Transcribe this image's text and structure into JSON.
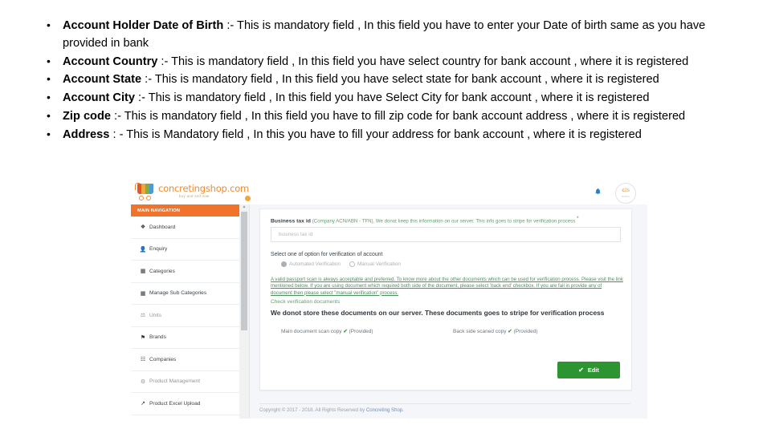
{
  "slide": {
    "bullets": [
      {
        "lead": "Account Holder Date of Birth",
        "rest": " :- This is mandatory field , In this field you have to enter your Date of birth same as you have provided in bank"
      },
      {
        "lead": "Account Country",
        "rest": " :- This is mandatory field , In this field you have select country for bank account , where it is registered"
      },
      {
        "lead": "Account State",
        "rest": " :- This is mandatory field , In this field you have select state for bank account , where it is registered"
      },
      {
        "lead": "Account City",
        "rest": " :- This is mandatory field , In this field you have Select City  for bank account , where it is registered"
      },
      {
        "lead": "Zip code",
        "rest": " :- This is mandatory field , In this field you have to fill zip code for bank account address , where it is registered"
      },
      {
        "lead": "Address",
        "rest": " : -  This is Mandatory field ,  In this you have to fill your address for bank account , where it is registered"
      }
    ]
  },
  "screenshot": {
    "brand": {
      "name": "concretingshop.com",
      "tagline": "buy and sell now"
    },
    "topbar": {
      "bell_icon": "bell-icon",
      "avatar_initials": [
        "c",
        "2",
        "s"
      ],
      "avatar_sub": "SUPPLY"
    },
    "sidebar": {
      "header": "MAIN NAVIGATION",
      "items": [
        {
          "label": "Dashboard",
          "icon": "dashboard-icon",
          "glyph": "❖"
        },
        {
          "label": "Enquiry",
          "icon": "user-icon",
          "glyph": "☰"
        },
        {
          "label": "Categories",
          "icon": "grid-icon",
          "glyph": "▦"
        },
        {
          "label": "Manage Sub Categories",
          "icon": "grid-icon",
          "glyph": "▦"
        },
        {
          "label": "Units",
          "icon": "units-icon",
          "glyph": "⚖"
        },
        {
          "label": "Brands",
          "icon": "tag-icon",
          "glyph": "⚑"
        },
        {
          "label": "Companies",
          "icon": "building-icon",
          "glyph": "☷"
        },
        {
          "label": "Product Management",
          "icon": "settings-icon",
          "glyph": "⚙"
        },
        {
          "label": "Product Excel Upload",
          "icon": "upload-icon",
          "glyph": "↗"
        }
      ]
    },
    "form": {
      "field_label": "Business tax id",
      "field_hint": "(Company ACN/ABN - TFN), We donot keep this information on our server. This info goes to stripe for verification process",
      "required_mark": "*",
      "input_placeholder": "business tax id",
      "input_value": "",
      "verification_title": "Select one of option for verification of account",
      "radio_options": [
        {
          "label": "Automated Verification",
          "selected": true
        },
        {
          "label": "Manual Verification",
          "selected": false
        }
      ],
      "green_note": "A valid passport scan is always acceptable and preferred. To know more about the other documents which can be used for verification process. Please visit the link mentioned below. If you are using document which required both side of the document, please select 'back end' checkbox. If you are fail in provide any of document then please select \"manual verification\" process.",
      "check_link": "Check verification documents",
      "store_note": "We donot store these documents on our server. These documents goes to stripe for verification process",
      "documents": [
        {
          "label": "Main document scan copy",
          "status": "(Provided)"
        },
        {
          "label": "Back side scaned copy",
          "status": "(Provided)"
        }
      ],
      "edit_button": "Edit"
    },
    "footer": {
      "copyright": "Copyright © 2017 - 2018. All Rights Reserved by ",
      "brand": "Concreting Shop."
    },
    "colors": {
      "accent_orange": "#f0722b",
      "brand_orange": "#f08a2e",
      "green": "#2c9430",
      "note_green": "#4b8f5c",
      "bell_blue": "#2f7fc1"
    }
  }
}
